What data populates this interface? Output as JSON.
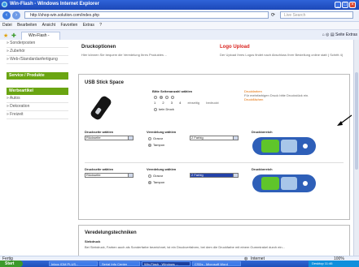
{
  "window": {
    "title": "Win-Flash - Windows Internet Explorer"
  },
  "address": {
    "url": "http://shop-win.solution.com/index.php",
    "search_placeholder": "Live Search"
  },
  "menu": [
    "Datei",
    "Bearbeiten",
    "Ansicht",
    "Favoriten",
    "Extras",
    "?"
  ],
  "tab": {
    "label": "Win-Flash -"
  },
  "toolbar": {
    "text": "Seite  Extras"
  },
  "sidebar": {
    "links_top": [
      "» Sonderposten",
      "» Zubehör",
      "» Web-/Standardanfertigung"
    ],
    "section1": "Service / Produkte",
    "section2": "Werbeartikel",
    "links_bottom": [
      "» Autos",
      "» Dekoration",
      "» Freizeit"
    ]
  },
  "druckoptionen": {
    "title": "Druckoptionen",
    "text": "Hier können Sie bequem die Veredelung Ihres Produktes ..."
  },
  "logo_upload": {
    "title": "Logo Upload",
    "text": "Der Upload Ihres Logos findet nach Abschluss Ihrer Bestellung online statt ( Schritt 4)"
  },
  "usb": {
    "title": "USB Stick Space",
    "count_label": "Bitte Seitenanzahl wählen",
    "count_options": [
      "1",
      "2",
      "3",
      "4"
    ],
    "single_side": "einseitig bedruckt",
    "no_print": "kein Druck",
    "side_note": "Druckfarben",
    "side_note2": "Für mehrfarbigen Druck bitte Druckstück ein.",
    "side_note3": "Druckflächen"
  },
  "row1": {
    "print_side_label": "Druckseite wählen",
    "print_side_value": "Rückseite",
    "finish_label": "Veredelung wählen",
    "finish_options": [
      "Gravur",
      "Tampon"
    ],
    "finish_selected": "Tampon",
    "color_value": "2 Farbig",
    "preview_label": "Druckbereich"
  },
  "row2": {
    "print_side_label": "Druckseite wählen",
    "print_side_value": "Rückseite",
    "finish_label": "Veredelung wählen",
    "finish_options": [
      "Gravur",
      "Tampon"
    ],
    "finish_selected": "Tampon",
    "color_value": "2 Farbig",
    "preview_label": "Druckbereich"
  },
  "veredelung": {
    "title": "Veredelungstechniken",
    "sub": "Siebdruck",
    "text": "Bei Siebdruck, Farben auch als Sonderfarbe bezeichnet, ist ein Druckverfahren, bei dem die Druckfarbe mit einem Gummirakel durch ein..."
  },
  "status": {
    "left": "Fertig",
    "zone": "Internet",
    "zoom": "100%"
  },
  "taskbar": {
    "start": "Start",
    "tasks": [
      "Inbox (DM PLUS...",
      "Serial Info Center",
      "Win-Flash - Windows ...",
      "CSDs - Microsoft Word"
    ],
    "tray": "Desktop  11:46"
  },
  "colors": {
    "accent_green": "#6aa512",
    "accent_orange": "#e46e00",
    "logo_red": "#d9231e",
    "usb_blue": "#2e5fb8",
    "usb_green": "#5fc52a"
  }
}
